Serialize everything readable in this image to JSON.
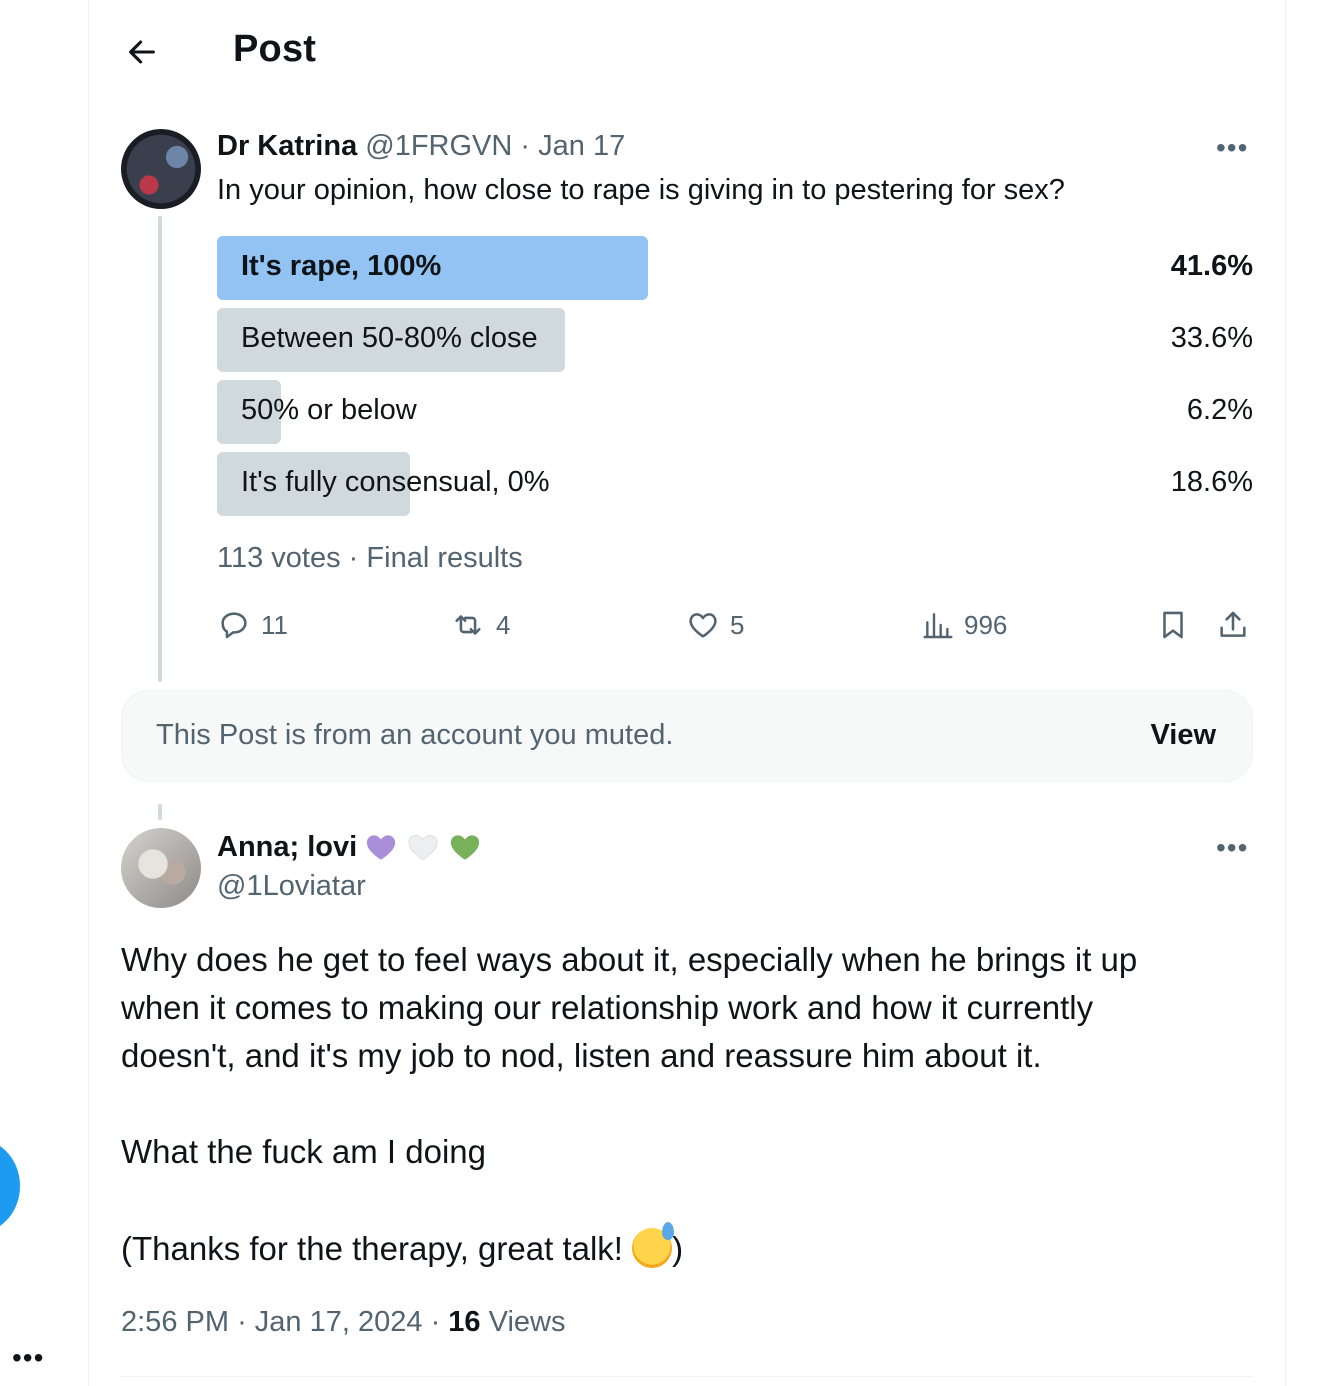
{
  "header": {
    "title": "Post"
  },
  "post": {
    "author_name": "Dr Katrina",
    "author_handle": "@1FRGVN",
    "separator": "·",
    "date": "Jan 17",
    "text": "In your opinion, how close to rape is giving in to pestering for sex?",
    "poll": {
      "options": [
        {
          "label": "It's rape, 100%",
          "percent": "41.6%",
          "fraction": 0.416,
          "winner": true
        },
        {
          "label": "Between 50-80% close",
          "percent": "33.6%",
          "fraction": 0.336,
          "winner": false
        },
        {
          "label": "50% or below",
          "percent": "6.2%",
          "fraction": 0.062,
          "winner": false
        },
        {
          "label": "It's fully consensual, 0%",
          "percent": "18.6%",
          "fraction": 0.186,
          "winner": false
        }
      ],
      "votes": "113 votes",
      "status": "Final results"
    },
    "actions": {
      "replies": "11",
      "reposts": "4",
      "likes": "5",
      "views": "996"
    }
  },
  "muted_notice": {
    "text": "This Post is from an account you muted.",
    "button": "View"
  },
  "reply": {
    "author_name": "Anna; lovi",
    "name_emojis": [
      "purple-heart",
      "white-heart",
      "green-heart"
    ],
    "author_handle": "@1Loviatar",
    "lines": [
      "Why does he get to feel ways about it, especially when he brings it up",
      "when it comes to making our relationship work and how it currently",
      "doesn't, and it's my job to nod, listen and reassure him about it."
    ],
    "line2": "What the fuck am I doing",
    "line3_before": "(Thanks for the therapy, great talk! ",
    "line3_after": ")",
    "emoji": "grinning-face-with-sweat",
    "time": "2:56 PM",
    "date": "Jan 17, 2024",
    "views_count": "16",
    "views_label": "Views"
  },
  "colors": {
    "accent": "#1d9bf0",
    "poll_winner": "#93c3f2",
    "poll_bar": "#cfd9de",
    "muted_text": "#536471"
  }
}
